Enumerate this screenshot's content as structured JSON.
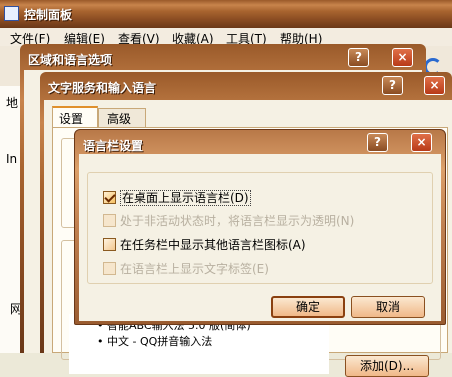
{
  "control_panel": {
    "title": "控制面板",
    "menu": [
      "文件(F)",
      "编辑(E)",
      "查看(V)",
      "收藏(A)",
      "工具(T)",
      "帮助(H)"
    ],
    "side_text_1": "地",
    "side_text_2": "In",
    "side_text_3": "网"
  },
  "region_dialog": {
    "title": "区域和语言选项",
    "help": "?",
    "close": "×"
  },
  "text_services_dialog": {
    "title": "文字服务和输入语言",
    "help": "?",
    "close": "×",
    "tabs": [
      "设置",
      "高级"
    ],
    "list_items": [
      "• 智能ABC输入法 5.0 版(简体)",
      "• 中文 - QQ拼音输入法"
    ],
    "add_button": "添加(D)..."
  },
  "langbar_dialog": {
    "title": "语言栏设置",
    "help": "?",
    "close": "×",
    "options": [
      {
        "label": "在桌面上显示语言栏(D)",
        "checked": true,
        "enabled": true
      },
      {
        "label": "处于非活动状态时，将语言栏显示为透明(N)",
        "checked": false,
        "enabled": false
      },
      {
        "label": "在任务栏中显示其他语言栏图标(A)",
        "checked": false,
        "enabled": true
      },
      {
        "label": "在语言栏上显示文字标签(E)",
        "checked": false,
        "enabled": false
      }
    ],
    "ok": "确定",
    "cancel": "取消"
  }
}
